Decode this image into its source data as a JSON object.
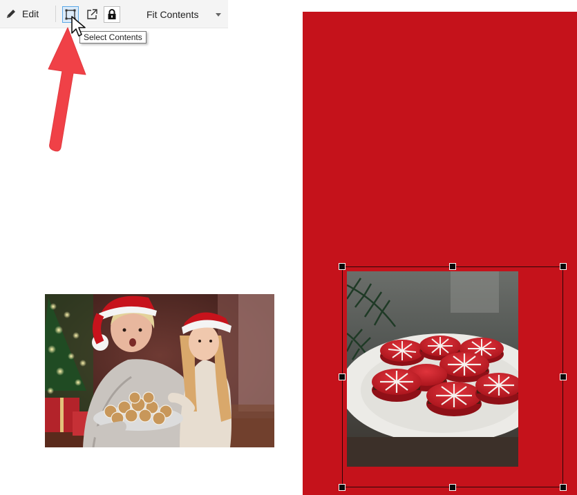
{
  "toolbar": {
    "edit_label": "Edit",
    "select_contents_icon": "select-contents-icon",
    "export_icon": "export-icon",
    "lock_icon": "lock-icon",
    "fit_label": "Fit Contents"
  },
  "tooltip": {
    "text": "Select Contents"
  },
  "annotation": {
    "arrow_icon": "red-arrow-icon",
    "arrow_color": "#f04147"
  },
  "canvas": {
    "page_color": "#c5121b",
    "photo1_subject": "grandmother-and-girl-with-cookies",
    "photo2_subject": "red-macarons-on-plate"
  }
}
